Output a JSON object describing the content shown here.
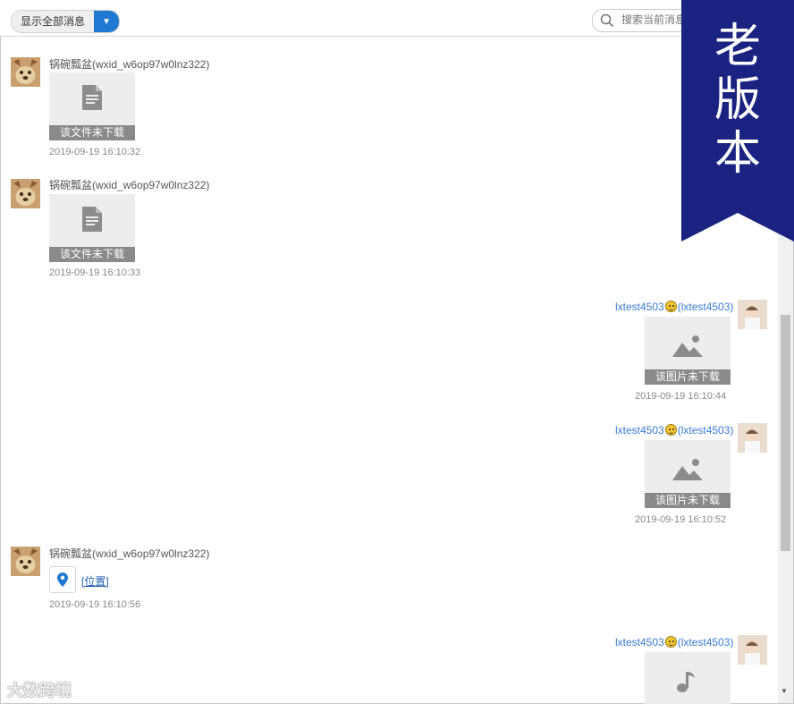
{
  "toolbar": {
    "filter_label": "显示全部消息",
    "filter_arrow": "▼",
    "search_placeholder": "搜索当前消息"
  },
  "icons": {
    "file": "file-document-icon",
    "image": "image-icon",
    "location": "location-pin-icon",
    "audio": "music-note-icon",
    "emoji": "grinning-face-emoji"
  },
  "colors": {
    "accent": "#1f78d1",
    "ribbon": "#1b2382",
    "sender_link": "#3a7bd5"
  },
  "messages": [
    {
      "side": "left",
      "sender": "锅碗瓢盆(wxid_w6op97w0lnz322)",
      "type": "file",
      "caption": "该文件未下载",
      "time": "2019-09-19 16:10:32"
    },
    {
      "side": "left",
      "sender": "锅碗瓢盆(wxid_w6op97w0lnz322)",
      "type": "file",
      "caption": "该文件未下载",
      "time": "2019-09-19 16:10:33"
    },
    {
      "side": "right",
      "sender_name": "lxtest4503",
      "sender_id": "(lxtest4503)",
      "type": "image",
      "caption": "该图片未下载",
      "time": "2019-09-19 16:10:44"
    },
    {
      "side": "right",
      "sender_name": "lxtest4503",
      "sender_id": "(lxtest4503)",
      "type": "image",
      "caption": "该图片未下载",
      "time": "2019-09-19 16:10:52"
    },
    {
      "side": "left",
      "sender": "锅碗瓢盆(wxid_w6op97w0lnz322)",
      "type": "location",
      "link": "[位置]",
      "time": "2019-09-19 16:10:56"
    },
    {
      "side": "right",
      "sender_name": "lxtest4503",
      "sender_id": "(lxtest4503)",
      "type": "audio"
    }
  ],
  "ribbon": {
    "line1": "老",
    "line2": "版",
    "line3": "本"
  },
  "watermark": "大数跨境"
}
